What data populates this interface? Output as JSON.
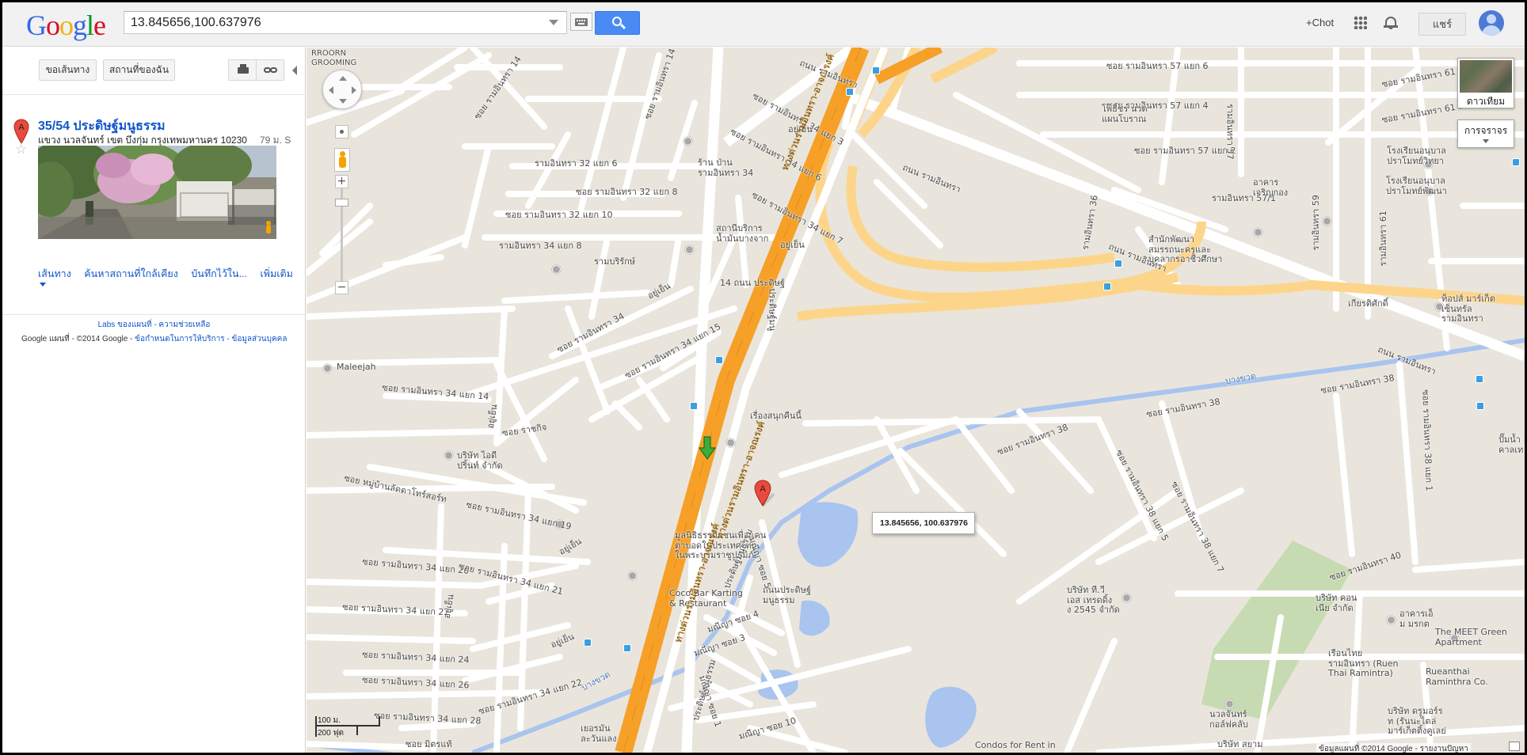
{
  "header": {
    "logo_letters": [
      "G",
      "o",
      "o",
      "g",
      "l",
      "e"
    ],
    "search_value": "13.845656,100.637976",
    "plus_user": "+Chot",
    "share_label": "แชร์"
  },
  "panel": {
    "directions_label": "ขอเส้นทาง",
    "my_places_label": "สถานที่ของฉัน",
    "result": {
      "marker_letter": "A",
      "title": "35/54 ประดิษฐ์มนูธรรม",
      "address": "แขวง นวลจันทร์ เขต บึงกุ่ม กรุงเทพมหานคร 10230",
      "distance": "79 ม. S"
    },
    "links": [
      "เส้นทาง",
      "ค้นหาสถานที่ใกล้เคียง",
      "บันทึกไว้ใน...",
      "เพิ่มเติม"
    ],
    "labs_text": "Labs ของแผนที่ - ความช่วยเหลือ",
    "footer_prefix": "Google แผนที่   - ©2014 Google  - ",
    "footer_links": "ข้อกำหนดในการให้บริการ - ข้อมูลส่วนบุคคล"
  },
  "map": {
    "satellite_label": "ดาวเทียม",
    "traffic_label": "การจราจร",
    "popup_text": "13.845656, 100.637976",
    "marker_letter": "A",
    "scale_metric": "100 ม.",
    "scale_imperial": "200 ฟุต",
    "attribution": "ข้อมูลแผนที่ ©2014 Google - รายงานปัญหา",
    "colors": {
      "land": "#e9e5dc",
      "road": "#ffffff",
      "highway": "#f7a028",
      "highway_ramp": "#fdd58a",
      "water": "#a8c4ef",
      "park": "#c7dbb2"
    },
    "labels": {
      "grooming": "RROORN\nGROOMING",
      "l_r34_14": "รามอินทรา 34 ซอย 14",
      "l_r14_v": "ซอย รามอินทรา 14",
      "l_r14_v2": "ซอย รามอินทรา 14",
      "l_r34_3": "ซอย รามอินทรา 34 แยก 3",
      "l_yuyen1": "อยู่เย็น",
      "l_r34_6": "ซอย รามอินทรา 34 แยก 6",
      "l_r34_7": "ซอย รามอินทรา 34 แยก 7",
      "l_shop": "ร้าน ป่าน\nรามอินทรา 34",
      "l_r32_6": "รามอินทรา 32 แยก 6",
      "l_r32_8": "ซอย รามอินทรา 32 แยก 8",
      "l_r32_10": "ซอย รามอินทรา 32 แยก 10",
      "l_r34_8": "รามอินทรา 34 แยก 8",
      "l_gas": "สถานีบริการ\nน้ำมันบางจาก",
      "l_yuyen2": "อยู่เย็น",
      "l_rambor": "รามบริรักษ์",
      "l_14": "14 ถนน ประดิษฐ์",
      "l_manu_v": "ประดิษฐ์มนู",
      "l_yuyen3": "อยู่เย็น",
      "l_r34": "ซอย รามอินทรา 34",
      "l_r34_15": "ซอย รามอินทรา 34 แยก 15",
      "l_maleejah": "Maleejah",
      "l_r34_14b": "ซอย รามอินทรา 34 แยก 14",
      "l_yuyen4": "อยู่เย็น",
      "l_ratchakij": "ซอย ราชกิจ",
      "l_print": "บริษัท ไอดี\nปริ้นท์ จำกัด",
      "l_moo": "ซอย หมู่บ้านลัดดาโทร์สอร์ท",
      "l_r34_19": "ซอย รามอินทรา 34 แยก 19",
      "l_yuyen5": "อยู่เย็น",
      "l_foundation": "มูลนิธิธรรมิกชนเพื่อแคน\nตาบอดในประเทศไทย\nในพระบรมราชูปถัมภ์",
      "l_r34_20": "ซอย รามอินทรา 34 แยก 20",
      "l_r34_21": "ซอย รามอินทรา 34 แยก 21",
      "l_r34_22": "ซอย รามอินทรา 34 แยก 22",
      "l_yuyen6": "อยู่เย็น",
      "l_yuyen7": "อยู่เย็น",
      "l_r34_24": "ซอย รามอินทรา 34 แยก 24",
      "l_r34_26": "ซอย รามอินทรา 34 แยก 26",
      "l_r34_28": "ซอย รามอินทรา 34 แยก 28",
      "l_r34_22b": "ซอย รามอินทรา 34 แยก 22",
      "l_mitr": "ซอย มิตรแท้",
      "l_coco": "Coco-Bar Karting\n& Restaurant",
      "l_road_manu": "ถนนประดิษฐ์\nมนูธรรม",
      "l_manu_main": "ประดิษฐ์มนูธรรม",
      "l_manu_main2": "ประดิษฐ์มนูธรรม",
      "l_expressway1": "ทางด่วนรามอินทรา-อาจณรงค์",
      "l_expressway2": "ทางด่วนรามอินทรา-อาจณรงค์",
      "l_expressway3": "ทางด่วนรามอินทรา-อาจณรงค์",
      "l_ramintra1": "ถนน รามอินทรา",
      "l_ramintra2": "ถนน รามอินทรา",
      "l_ramintra3": "ถนน รามอินทรา",
      "l_ramintra4": "ถนน รามอินทรา",
      "l_r57_6": "ซอย รามอินทรา 57 แยก 6",
      "l_r57_4": "ซอย รามอินทรา 57 แยก 4",
      "l_r57_2": "ซอย รามอินทรา 57 แยก 2",
      "l_r57_1": "รามอินทรา 57/1",
      "l_r61_4": "ซอย รามอินทรา 61 แยก 4",
      "l_r61_2": "ซอย รามอินทรา 61 แยก 2",
      "l_r57_v": "รามอินทรา 57",
      "l_r59_v": "รามอินทรา 59",
      "l_r61_v": "รามอินทรา 61",
      "l_r36_v": "รามอินทรา 36",
      "l_phot": "โพธิ์ชร นวด\nแผนโบราณ",
      "l_school1": "โรงเรียนอนุบาล\nปราโมทย์วิทยา",
      "l_school2": "โรงเรียนอนุบาล\nปราโมทย์พัฒนา",
      "l_office": "สำนักพัฒนา\nสมรรถนะครูและ\nบุคลากรอาชีวศึกษา",
      "l_bldg": "อาคาร\nเจริญกอง",
      "l_kiat": "เกียรติศักดิ์",
      "l_topsmkt": "ท็อปส์ มาร์เก็ต\nเซ็นทรัล\nรามอินทรา",
      "l_bangkhen": "บางขวด",
      "l_bangkhen2": "บางขวด",
      "l_r38": "ซอย รามอินทรา 38",
      "l_r38b": "ซอย รามอินทรา 38",
      "l_r38c": "ซอย รามอินทรา 38",
      "l_r38_5": "ซอย รามอินทรา 38 แยก 5",
      "l_r38_7": "ซอย รามอินทรา 38 แยก 7",
      "l_r38_1": "ซอย รามอินทรา 38 แยก 1",
      "l_r40": "ซอย รามอินทรา 40",
      "l_story": "เรื่องสนุกคืนนี้",
      "l_mnia5": "มณีญา ซอย 5",
      "l_mnia4": "มณีญา ซอย 4",
      "l_mnia3": "มณีญา ซอย 3",
      "l_mnia1": "มณีญา ซอย 1",
      "l_mnia10": "มณีญา ซอย 10",
      "l_tees": "บริษัท ที.วี\nเอส เทรดดิ้ง\nง 2545 จำกัด",
      "l_coun": "บริษัท คอน\nเนีย จำกัด",
      "l_mrk": "อาคารเอ็\nม มรกต",
      "l_meet": "The MEET Green\nApartment",
      "l_ruen": "เรือนไทย\nรามอินทรา (Ruen\nThai Ramintra)",
      "l_ruenthai": "Rueanthai\nRaminthra Co.",
      "l_golf": "นวลจันทร์\nกอล์ฟคลับ",
      "l_rsp": "บริษัท ดรูมอร์ร\nท (รันนะไตล่\nมาร์เก็ตติ้งคูเลย่",
      "l_condo": "Condos for Rent in",
      "l_saim": "บริษัท สยาม",
      "l_yemon": "เยอรมัน\nละวันแลง",
      "l_pum": "ปั๊มน้ำ\nคาลเท"
    }
  }
}
